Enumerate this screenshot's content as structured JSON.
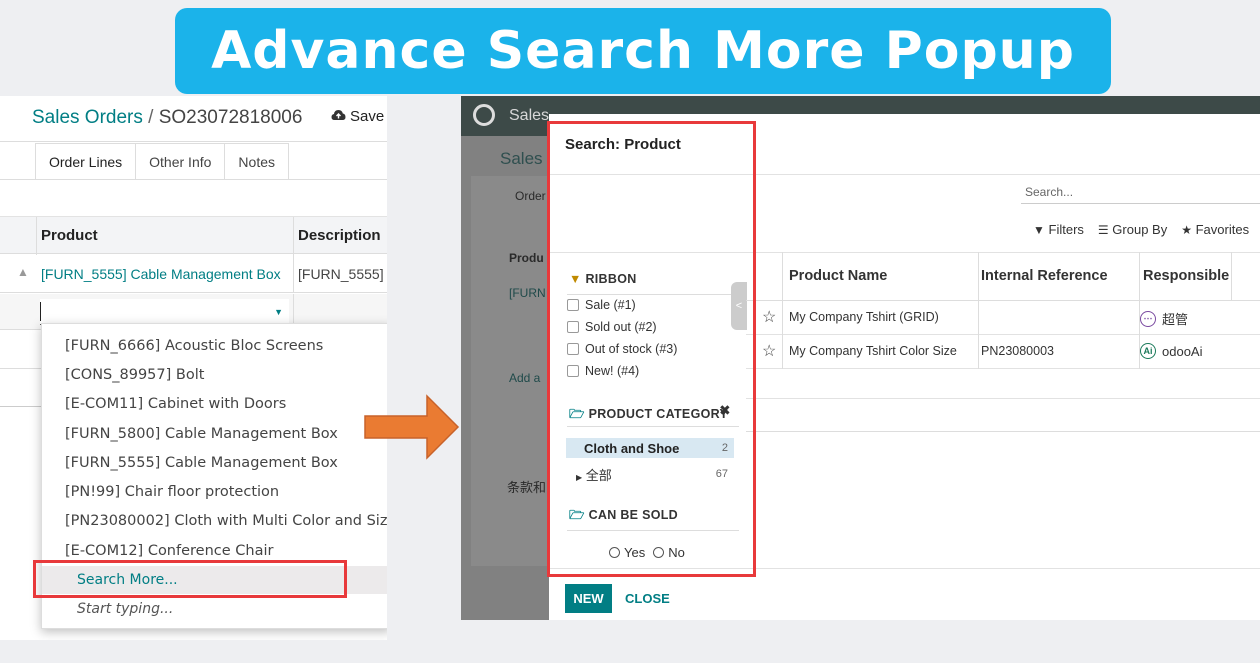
{
  "banner": {
    "title": "Advance Search More Popup"
  },
  "left": {
    "breadcrumb_parent": "Sales Orders",
    "breadcrumb_sep": "/",
    "breadcrumb_current": "SO23072818006",
    "save_label": "Save",
    "tabs": [
      {
        "label": "Order Lines"
      },
      {
        "label": "Other Info"
      },
      {
        "label": "Notes"
      }
    ],
    "columns": {
      "product": "Product",
      "description": "Description"
    },
    "row": {
      "product": "[FURN_5555] Cable Management Box",
      "description": "[FURN_5555]"
    },
    "dropdown_items": [
      "[FURN_6666] Acoustic Bloc Screens",
      "[CONS_89957] Bolt",
      "[E-COM11] Cabinet with Doors",
      "[FURN_5800] Cable Management Box",
      "[FURN_5555] Cable Management Box",
      "[PN!99] Chair floor protection",
      "[PN23080002] Cloth with Multi Color and Size",
      "[E-COM12] Conference Chair"
    ],
    "search_more": "Search More...",
    "start_typing": "Start typing..."
  },
  "right": {
    "nav_app": "Sales",
    "bg_title": "Sales",
    "bg_order": "Order",
    "bg_product": "Produ",
    "bg_furn": "[FURN",
    "bg_add": "Add a",
    "bg_terms": "条款和",
    "modal": {
      "title": "Search: Product",
      "search_placeholder": "Search...",
      "filters": "Filters",
      "group_by": "Group By",
      "favorites": "Favorites",
      "ribbon_title": "RIBBON",
      "ribbon_options": [
        "Sale (#1)",
        "Sold out (#2)",
        "Out of stock (#3)",
        "New! (#4)"
      ],
      "category_title": "PRODUCT CATEGORY",
      "categories": [
        {
          "name": "Cloth and Shoe",
          "count": "2"
        },
        {
          "name": "全部",
          "count": "67"
        }
      ],
      "sold_title": "CAN BE SOLD",
      "yes": "Yes",
      "no": "No",
      "columns": {
        "name": "Product Name",
        "ref": "Internal Reference",
        "resp": "Responsible"
      },
      "rows": [
        {
          "name": "My Company Tshirt (GRID)",
          "ref": "",
          "resp": "超管"
        },
        {
          "name": "My Company Tshirt Color Size",
          "ref": "PN23080003",
          "resp": "odooAi"
        }
      ],
      "new_label": "NEW",
      "close_label": "CLOSE"
    }
  },
  "colors": {
    "banner": "#1bb3ea",
    "accent": "#017e84",
    "highlight": "#e8393b",
    "arrow": "#ea7b32"
  }
}
